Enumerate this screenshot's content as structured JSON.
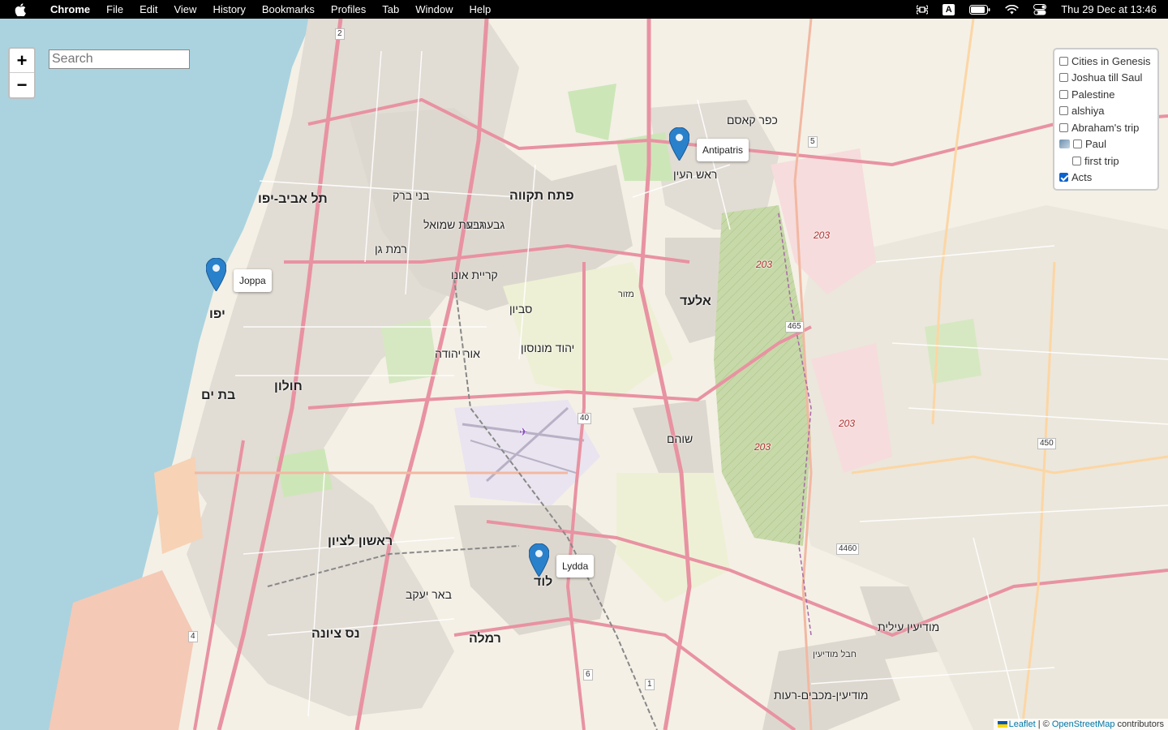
{
  "menubar": {
    "app": "Chrome",
    "items": [
      "File",
      "Edit",
      "View",
      "History",
      "Bookmarks",
      "Profiles",
      "Tab",
      "Window",
      "Help"
    ],
    "keyboard": "A",
    "clock": "Thu 29 Dec at 13:46"
  },
  "map": {
    "search_placeholder": "Search",
    "zoom_in": "+",
    "zoom_out": "−",
    "layers": [
      {
        "label": "Cities in Genesis",
        "checked": false
      },
      {
        "label": "Joshua till Saul",
        "checked": false
      },
      {
        "label": "Palestine",
        "checked": false
      },
      {
        "label": "alshiya",
        "checked": false
      },
      {
        "label": "Abraham's trip",
        "checked": false
      },
      {
        "label": "Paul",
        "checked": false
      },
      {
        "label": "first trip",
        "checked": false
      },
      {
        "label": "Acts",
        "checked": true
      }
    ],
    "markers": [
      {
        "label": "Joppa"
      },
      {
        "label": "Antipatris"
      },
      {
        "label": "Lydda"
      }
    ],
    "attribution": {
      "leaflet": "Leaflet",
      "sep": " | © ",
      "osm": "OpenStreetMap",
      "suffix": " contributors"
    },
    "place_labels": [
      "תל אביב-יפו",
      "פתח תקווה",
      "ראש העין",
      "רמת גן",
      "בני ברק",
      "גבעתיים",
      "חולון",
      "בת ים",
      "ראשון לציון",
      "נס ציונה",
      "רמלה",
      "לוד",
      "באר יעקב",
      "יהוד מונוסון",
      "אור יהודה",
      "שוהם",
      "אלעד",
      "מודיעין-מכבים-רעות",
      "קריית אונו",
      "סביון",
      "גבעת שמואל",
      "יפו",
      "מודיעין עילית",
      "כפר קאסם",
      "חבל מודיעין",
      "מזור",
      "ראש העין"
    ],
    "roads": [
      "2",
      "5",
      "465",
      "40",
      "450",
      "4460",
      "4",
      "6",
      "1"
    ],
    "numbers": [
      "203",
      "203",
      "203",
      "203"
    ]
  }
}
